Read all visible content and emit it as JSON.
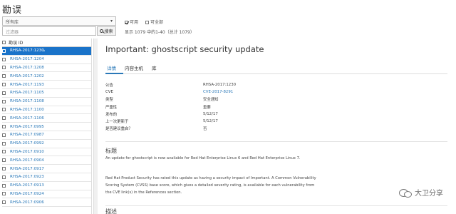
{
  "page": {
    "title": "勘误"
  },
  "filter": {
    "selected": "所有库"
  },
  "search": {
    "placeholder": "过滤器",
    "button_label": "搜索"
  },
  "options": {
    "installable_label": "可用",
    "applicable_label": "可全部",
    "installable_checked": true,
    "applicable_checked": false
  },
  "count": {
    "text": "显示 1079 中的1-40（总计 1079）"
  },
  "list": {
    "header_label": "勘误 ID",
    "items": [
      {
        "id": "RHSA-2017:1230",
        "selected": true
      },
      {
        "id": "RHSA-2017:1204"
      },
      {
        "id": "RHSA-2017:1208"
      },
      {
        "id": "RHSA-2017:1202"
      },
      {
        "id": "RHSA-2017:1193"
      },
      {
        "id": "RHSA-2017:1105"
      },
      {
        "id": "RHSA-2017:1108"
      },
      {
        "id": "RHSA-2017:1100"
      },
      {
        "id": "RHSA-2017:1106"
      },
      {
        "id": "RHSA-2017:0995"
      },
      {
        "id": "RHSA-2017:0987"
      },
      {
        "id": "RHSA-2017:0992"
      },
      {
        "id": "RHSA-2017:0910"
      },
      {
        "id": "RHSA-2017:0904"
      },
      {
        "id": "RHSA-2017:0917"
      },
      {
        "id": "RHSA-2017:0923"
      },
      {
        "id": "RHSA-2017:0913"
      },
      {
        "id": "RHSA-2017:0924"
      },
      {
        "id": "RHSA-2017:0906"
      }
    ]
  },
  "detail": {
    "title": "Important: ghostscript security update",
    "tabs": [
      {
        "label": "详情",
        "active": true
      },
      {
        "label": "内容主机"
      },
      {
        "label": "库"
      }
    ],
    "fields": [
      {
        "key": "公告",
        "value": "RHSA-2017:1230"
      },
      {
        "key": "CVE",
        "value": "CVE-2017-8291",
        "link": true
      },
      {
        "key": "类型",
        "value": "安全通知"
      },
      {
        "key": "严重性",
        "value": "重要"
      },
      {
        "key": "发布的",
        "value": "5/12/17"
      },
      {
        "key": "上一次更新于",
        "value": "5/12/17"
      },
      {
        "key": "是否建议重启？",
        "value": "否"
      }
    ],
    "title_section": {
      "heading": "标题",
      "text": "An update for ghostscript is now available for Red Hat Enterprise Linux 6 and Red Hat Enterprise Linux 7."
    },
    "body_text": "Red Hat Product Security has rated this update as having a security impact of Important. A Common Vulnerability Scoring System (CVSS) base score, which gives a detailed severity rating, is available for each vulnerability from the CVE link(s) in the References section.",
    "description_heading": "描述"
  },
  "watermark": {
    "text": "大卫分享"
  }
}
